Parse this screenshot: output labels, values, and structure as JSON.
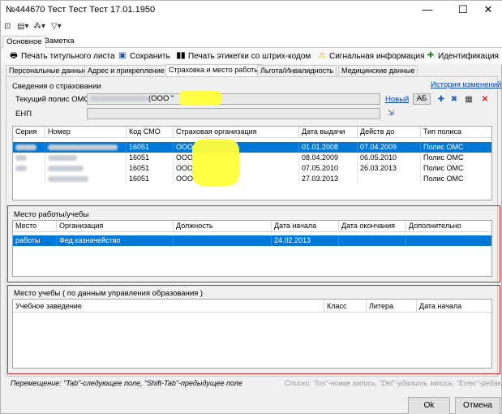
{
  "window": {
    "title": "№444670 Тест Тест Тест 17.01.1950",
    "minimize": "—",
    "maximize": "☐",
    "close": "✕"
  },
  "ribbon_tabs": [
    "Основное",
    "Заметка"
  ],
  "toolbar": [
    {
      "label": "Печать титульного листа",
      "icon": "printer-icon"
    },
    {
      "label": "Сохранить",
      "icon": "save-icon"
    },
    {
      "label": "Печать этикетки со штрих-кодом",
      "icon": "barcode-icon"
    },
    {
      "label": "Сигнальная информация",
      "icon": "warning-icon"
    },
    {
      "label": "Идентификация",
      "icon": "identify-icon"
    }
  ],
  "tabs": [
    "Персональные данные",
    "Адрес и прикрепление",
    "Страховка и место работы",
    "Льгота/Инвалидность",
    "Медицинские данные"
  ],
  "insurance": {
    "group_label": "Сведения о страховании",
    "history_link": "История изменений",
    "policy_label": "Текущий полис ОМС",
    "policy_value": "(ООО \"",
    "new_link": "Новый",
    "ab_button": "АБ",
    "enp_label": "ЕНП",
    "columns": [
      "Серия",
      "Номер",
      "Код СМО",
      "Страховая организация",
      "Дата выдачи",
      "Действ до",
      "Тип полиса"
    ],
    "rows": [
      {
        "code": "16051",
        "org": "ООО \"",
        "issued": "01.01.2008",
        "valid": "07.04.2009",
        "type": "Полис ОМС"
      },
      {
        "code": "16051",
        "org": "ООО \"",
        "issued": "08.04.2009",
        "valid": "06.05.2010",
        "type": "Полис ОМС"
      },
      {
        "code": "16051",
        "org": "ООО \"",
        "issued": "07.05.2010",
        "valid": "26.03.2013",
        "type": "Полис ОМС"
      },
      {
        "code": "16051",
        "org": "ООО \"",
        "issued": "27.03.2013",
        "valid": "",
        "type": "Полис ОМС"
      }
    ]
  },
  "work": {
    "group_label": "Место работы/учебы",
    "columns": [
      "Место",
      "Организация",
      "Должность",
      "Дата начала",
      "Дата окончания",
      "Дополнительно"
    ],
    "rows": [
      {
        "place": "работы",
        "org": "Фед.казначейство",
        "position": "",
        "start": "24.02.2013",
        "end": "",
        "extra": ""
      }
    ]
  },
  "study": {
    "group_label": "Место учебы ( по данным управления образования )",
    "columns": [
      "Учебное заведение",
      "Класс",
      "Литера",
      "Дата начала"
    ]
  },
  "status": {
    "left": "Перемещение: \"Tab\"-следующее поле, \"Shift-Tab\"-предыдущее поле",
    "right": "Списки: \"Ins\"-новая запись, \"Del\"-удалить запись; \"Enter\"-редактиро"
  },
  "buttons": {
    "ok": "Ok",
    "cancel": "Отмена"
  },
  "colors": {
    "selection": "#0078d7",
    "redaction": "#ffff3a",
    "annotation_box": "#c8262d"
  }
}
